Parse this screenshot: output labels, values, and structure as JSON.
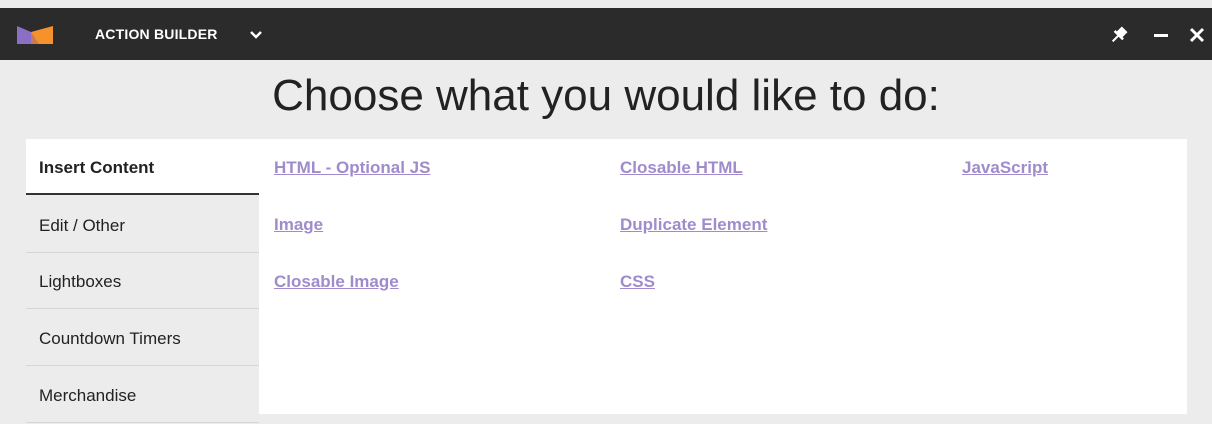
{
  "titlebar": {
    "title": "ACTION BUILDER",
    "logo_icon": "app-logo-icon",
    "dropdown_icon": "chevron-down-icon",
    "pin_icon": "pin-icon",
    "minimize_icon": "minimize-icon",
    "close_icon": "close-icon"
  },
  "heading": "Choose what you would like to do:",
  "sidebar": {
    "tabs": [
      {
        "label": "Insert Content",
        "active": true
      },
      {
        "label": "Edit / Other"
      },
      {
        "label": "Lightboxes"
      },
      {
        "label": "Countdown Timers"
      },
      {
        "label": "Merchandise"
      }
    ]
  },
  "options": [
    "HTML - Optional JS",
    "Closable HTML",
    "JavaScript",
    "Image",
    "Duplicate Element",
    "Closable Image",
    "CSS"
  ],
  "colors": {
    "titlebar_bg": "#2b2b2b",
    "page_bg": "#ececec",
    "link": "#a08bcc",
    "logo_orange": "#f5922b",
    "logo_purple": "#8a6fc7"
  }
}
